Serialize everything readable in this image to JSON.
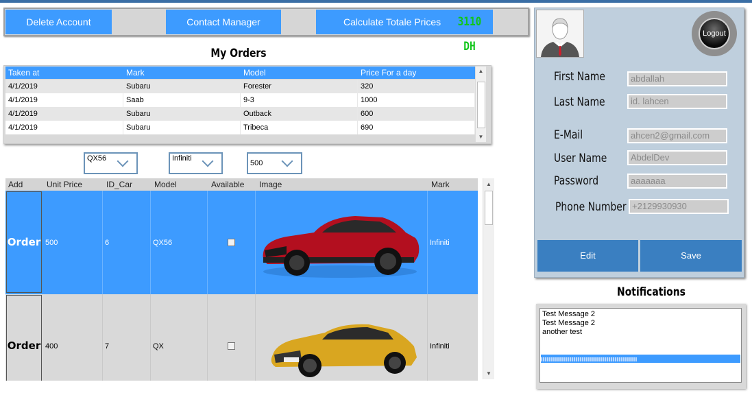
{
  "toolbar": {
    "delete_label": "Delete Account",
    "contact_label": "Contact Manager",
    "calculate_label": "Calculate Totale Prices",
    "total_value": "3110 DH",
    "total_color": "#11c51a"
  },
  "orders": {
    "title": "My Orders",
    "columns": [
      "Taken at",
      "Mark",
      "Model",
      "Price For a day"
    ],
    "rows": [
      [
        "4/1/2019",
        "Subaru",
        "Forester",
        "320"
      ],
      [
        "4/1/2019",
        "Saab",
        "9-3",
        "1000"
      ],
      [
        "4/1/2019",
        "Subaru",
        "Outback",
        "600"
      ],
      [
        "4/1/2019",
        "Subaru",
        "Tribeca",
        "690"
      ]
    ]
  },
  "filters": {
    "model": "QX56",
    "mark": "Infiniti",
    "price": "500"
  },
  "cars": {
    "columns": [
      "Add",
      "Unit Price",
      "ID_Car",
      "Model",
      "Available",
      "Image",
      "Mark"
    ],
    "order_label": "Order",
    "rows": [
      {
        "unit_price": "500",
        "id": "6",
        "model": "QX56",
        "available": false,
        "image": "red-muscle-car",
        "mark": "Infiniti",
        "selected": true
      },
      {
        "unit_price": "400",
        "id": "7",
        "model": "QX",
        "available": false,
        "image": "yellow-sedan-car",
        "mark": "Infiniti",
        "selected": false
      }
    ]
  },
  "profile": {
    "logout_label": "Logout",
    "first_name_label": "First Name",
    "first_name": "abdallah",
    "last_name_label": "Last Name",
    "last_name": "id. lahcen",
    "email_label": "E-Mail",
    "email": "ahcen2@gmail.com",
    "username_label": "User Name",
    "username": "AbdelDev",
    "password_label": "Password",
    "password": "aaaaaaa",
    "phone_label": "Phone Number",
    "phone": "+2129930930",
    "edit_label": "Edit",
    "save_label": "Save"
  },
  "notifications": {
    "title": "Notifications",
    "messages": [
      "Test Message 2",
      "Test Message 2",
      "another test"
    ],
    "progress": 0.48
  },
  "colors": {
    "accent": "#3d9bff",
    "panel": "#bfcfdd",
    "button_dark": "#3a7fc1"
  }
}
